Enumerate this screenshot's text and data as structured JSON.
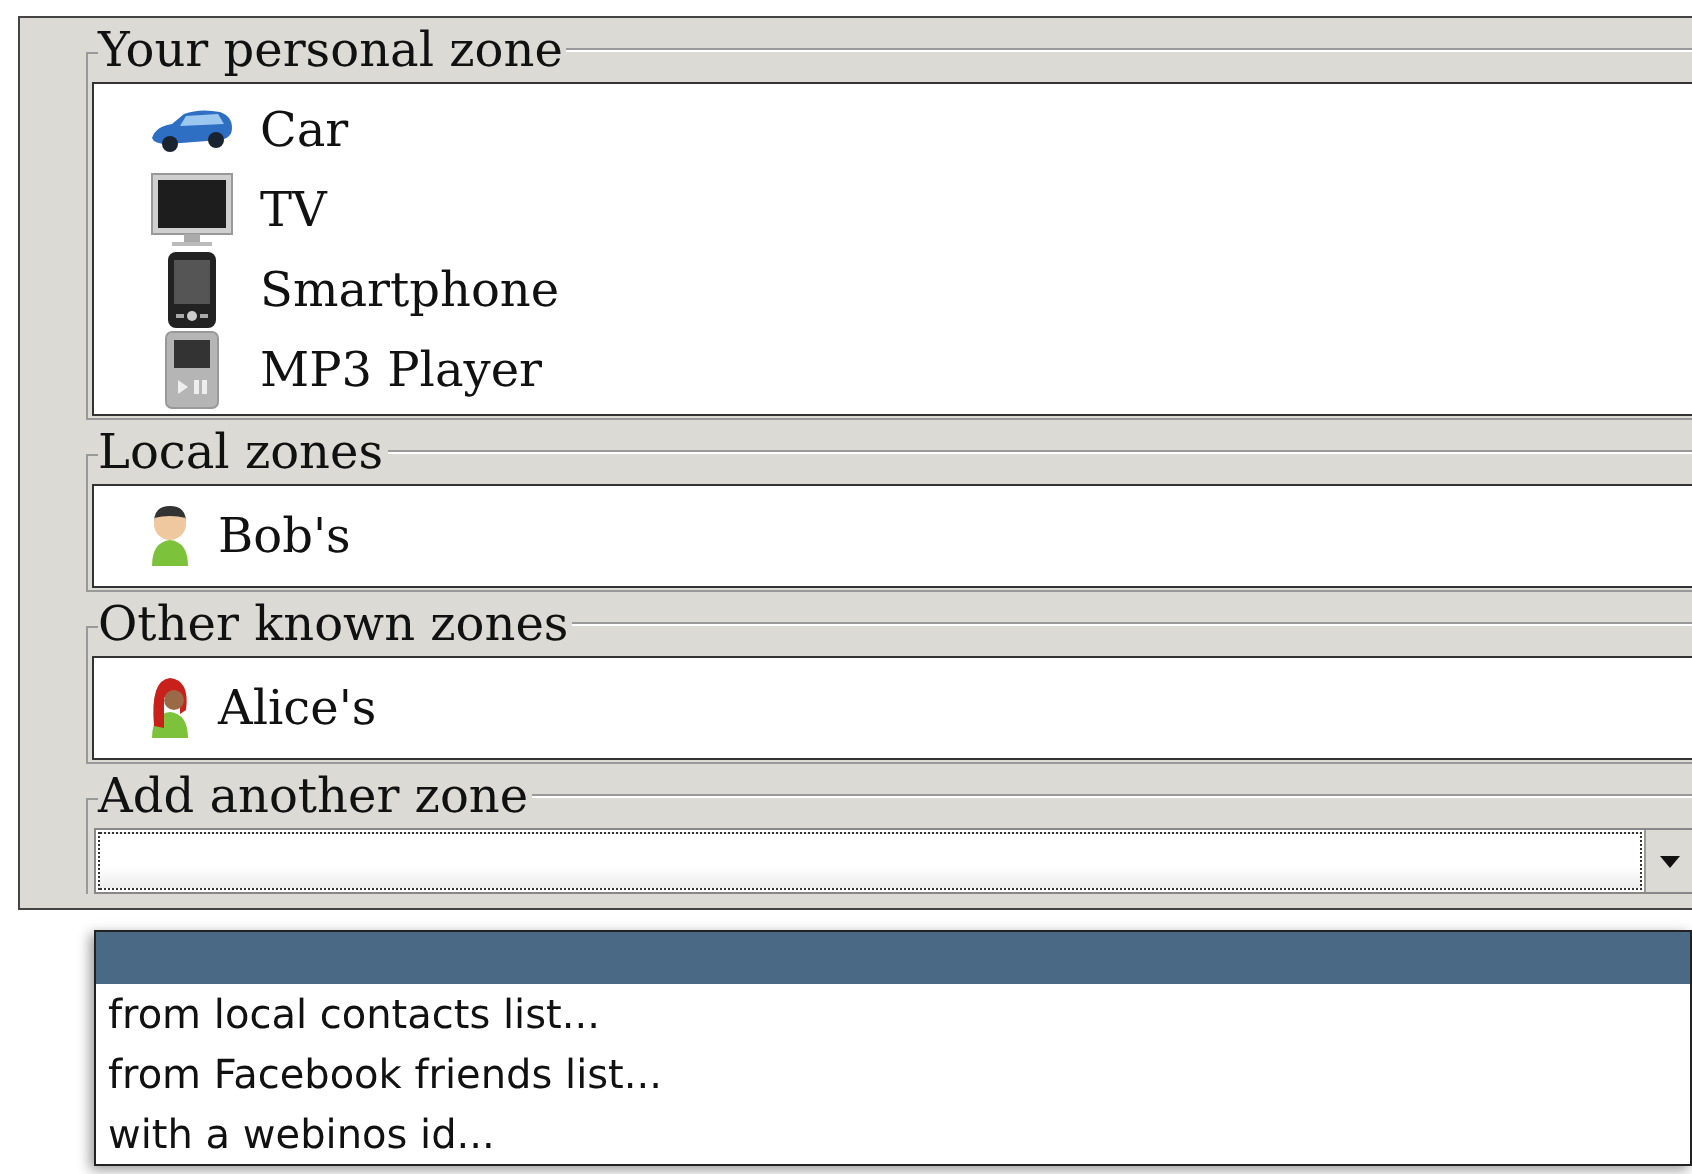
{
  "zones": [
    {
      "legend": "Your personal zone",
      "items": [
        {
          "kind": "car",
          "label": "Car"
        },
        {
          "kind": "tv",
          "label": "TV"
        },
        {
          "kind": "smartphone",
          "label": "Smartphone"
        },
        {
          "kind": "mp3",
          "label": "MP3 Player"
        }
      ]
    },
    {
      "legend": "Local zones",
      "items": [
        {
          "kind": "man",
          "label": "Bob's"
        }
      ]
    },
    {
      "legend": "Other known zones",
      "items": [
        {
          "kind": "woman",
          "label": "Alice's"
        }
      ]
    }
  ],
  "add_zone": {
    "legend": "Add another zone",
    "open": true,
    "blank_option_selected": true,
    "options": [
      {
        "label": "from local contacts list...",
        "selected": false
      },
      {
        "label": "from Facebook friends list...",
        "selected": false
      },
      {
        "label": "with a webinos id...",
        "selected": false
      }
    ]
  }
}
